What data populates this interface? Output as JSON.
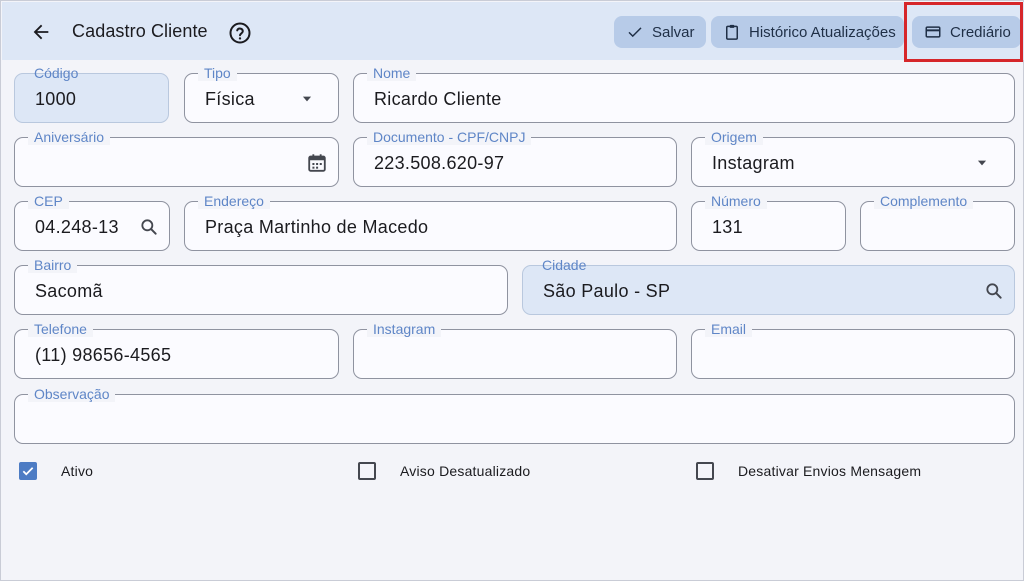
{
  "header": {
    "title": "Cadastro Cliente",
    "actions": {
      "save": "Salvar",
      "history": "Histórico Atualizações",
      "credit": "Crediário"
    }
  },
  "form": {
    "codigo": {
      "label": "Código",
      "value": "1000"
    },
    "tipo": {
      "label": "Tipo",
      "value": "Física"
    },
    "nome": {
      "label": "Nome",
      "value": "Ricardo Cliente"
    },
    "aniversario": {
      "label": "Aniversário",
      "value": ""
    },
    "documento": {
      "label": "Documento - CPF/CNPJ",
      "value": "223.508.620-97"
    },
    "origem": {
      "label": "Origem",
      "value": "Instagram"
    },
    "cep": {
      "label": "CEP",
      "value": "04.248-13"
    },
    "endereco": {
      "label": "Endereço",
      "value": "Praça Martinho de Macedo"
    },
    "numero": {
      "label": "Número",
      "value": "131"
    },
    "complemento": {
      "label": "Complemento",
      "value": ""
    },
    "bairro": {
      "label": "Bairro",
      "value": "Sacomã"
    },
    "cidade": {
      "label": "Cidade",
      "value": "São Paulo - SP"
    },
    "telefone": {
      "label": "Telefone",
      "value": "(11) 98656-4565"
    },
    "instagram": {
      "label": "Instagram",
      "value": ""
    },
    "email": {
      "label": "Email",
      "value": ""
    },
    "observacao": {
      "label": "Observação",
      "value": ""
    }
  },
  "checks": {
    "ativo": {
      "label": "Ativo",
      "checked": true
    },
    "aviso": {
      "label": "Aviso Desatualizado",
      "checked": false
    },
    "desativar": {
      "label": "Desativar Envios Mensagem",
      "checked": false
    }
  },
  "colors": {
    "appbar": "#dde7f6",
    "button": "#b7cbe8",
    "label": "#5f86c7",
    "highlight": "#d6262a",
    "check": "#4d7cc4"
  }
}
